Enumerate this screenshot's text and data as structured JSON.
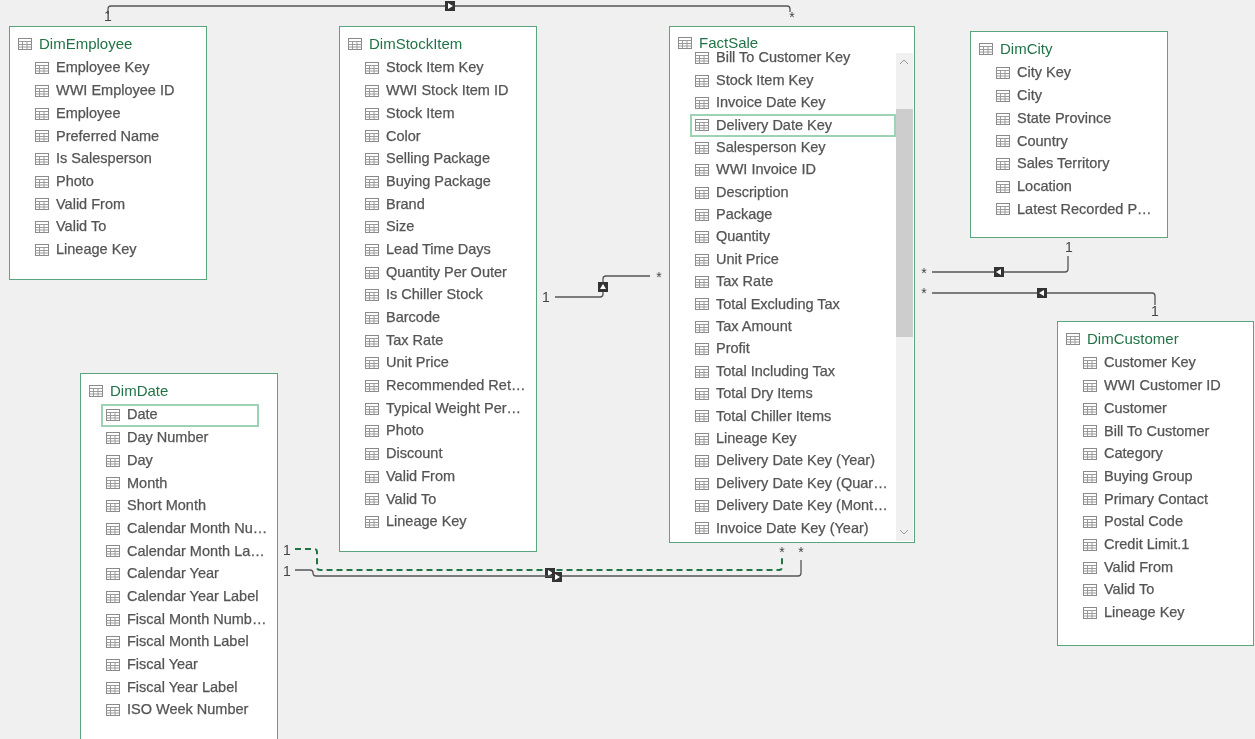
{
  "tables": [
    {
      "name": "DimEmployee",
      "columns": [
        {
          "label": "Employee Key",
          "selected": false
        },
        {
          "label": "WWI Employee ID",
          "selected": false
        },
        {
          "label": "Employee",
          "selected": false
        },
        {
          "label": "Preferred Name",
          "selected": false
        },
        {
          "label": "Is Salesperson",
          "selected": false
        },
        {
          "label": "Photo",
          "selected": false
        },
        {
          "label": "Valid From",
          "selected": false
        },
        {
          "label": "Valid To",
          "selected": false
        },
        {
          "label": "Lineage Key",
          "selected": false
        }
      ]
    },
    {
      "name": "DimStockItem",
      "columns": [
        {
          "label": "Stock Item Key",
          "selected": false
        },
        {
          "label": "WWI Stock Item ID",
          "selected": false
        },
        {
          "label": "Stock Item",
          "selected": false
        },
        {
          "label": "Color",
          "selected": false
        },
        {
          "label": "Selling Package",
          "selected": false
        },
        {
          "label": "Buying Package",
          "selected": false
        },
        {
          "label": "Brand",
          "selected": false
        },
        {
          "label": "Size",
          "selected": false
        },
        {
          "label": "Lead Time Days",
          "selected": false
        },
        {
          "label": "Quantity Per Outer",
          "selected": false
        },
        {
          "label": "Is Chiller Stock",
          "selected": false
        },
        {
          "label": "Barcode",
          "selected": false
        },
        {
          "label": "Tax Rate",
          "selected": false
        },
        {
          "label": "Unit Price",
          "selected": false
        },
        {
          "label": "Recommended Ret…",
          "selected": false
        },
        {
          "label": "Typical Weight Per…",
          "selected": false
        },
        {
          "label": "Photo",
          "selected": false
        },
        {
          "label": "Discount",
          "selected": false
        },
        {
          "label": "Valid From",
          "selected": false
        },
        {
          "label": "Valid To",
          "selected": false
        },
        {
          "label": "Lineage Key",
          "selected": false
        }
      ]
    },
    {
      "name": "FactSale",
      "scrollable": true,
      "columns": [
        {
          "label": "Bill To Customer Key",
          "selected": false
        },
        {
          "label": "Stock Item Key",
          "selected": false
        },
        {
          "label": "Invoice Date Key",
          "selected": false
        },
        {
          "label": "Delivery Date Key",
          "selected": true
        },
        {
          "label": "Salesperson Key",
          "selected": false
        },
        {
          "label": "WWI Invoice ID",
          "selected": false
        },
        {
          "label": "Description",
          "selected": false
        },
        {
          "label": "Package",
          "selected": false
        },
        {
          "label": "Quantity",
          "selected": false
        },
        {
          "label": "Unit Price",
          "selected": false
        },
        {
          "label": "Tax Rate",
          "selected": false
        },
        {
          "label": "Total Excluding Tax",
          "selected": false
        },
        {
          "label": "Tax Amount",
          "selected": false
        },
        {
          "label": "Profit",
          "selected": false
        },
        {
          "label": "Total Including Tax",
          "selected": false
        },
        {
          "label": "Total Dry Items",
          "selected": false
        },
        {
          "label": "Total Chiller Items",
          "selected": false
        },
        {
          "label": "Lineage Key",
          "selected": false
        },
        {
          "label": "Delivery Date Key (Year)",
          "selected": false
        },
        {
          "label": "Delivery Date Key (Quar…",
          "selected": false
        },
        {
          "label": "Delivery Date Key (Mont…",
          "selected": false
        },
        {
          "label": "Invoice Date Key (Year)",
          "selected": false
        }
      ]
    },
    {
      "name": "DimCity",
      "columns": [
        {
          "label": "City Key",
          "selected": false
        },
        {
          "label": "City",
          "selected": false
        },
        {
          "label": "State Province",
          "selected": false
        },
        {
          "label": "Country",
          "selected": false
        },
        {
          "label": "Sales Territory",
          "selected": false
        },
        {
          "label": "Location",
          "selected": false
        },
        {
          "label": "Latest Recorded P…",
          "selected": false
        }
      ]
    },
    {
      "name": "DimDate",
      "columns": [
        {
          "label": "Date",
          "selected": true
        },
        {
          "label": "Day Number",
          "selected": false
        },
        {
          "label": "Day",
          "selected": false
        },
        {
          "label": "Month",
          "selected": false
        },
        {
          "label": "Short Month",
          "selected": false
        },
        {
          "label": "Calendar Month Nu…",
          "selected": false
        },
        {
          "label": "Calendar Month La…",
          "selected": false
        },
        {
          "label": "Calendar Year",
          "selected": false
        },
        {
          "label": "Calendar Year Label",
          "selected": false
        },
        {
          "label": "Fiscal Month Numb…",
          "selected": false
        },
        {
          "label": "Fiscal Month Label",
          "selected": false
        },
        {
          "label": "Fiscal Year",
          "selected": false
        },
        {
          "label": "Fiscal Year Label",
          "selected": false
        },
        {
          "label": "ISO Week Number",
          "selected": false
        }
      ]
    },
    {
      "name": "DimCustomer",
      "columns": [
        {
          "label": "Customer Key",
          "selected": false
        },
        {
          "label": "WWI Customer ID",
          "selected": false
        },
        {
          "label": "Customer",
          "selected": false
        },
        {
          "label": "Bill To Customer",
          "selected": false
        },
        {
          "label": "Category",
          "selected": false
        },
        {
          "label": "Buying Group",
          "selected": false
        },
        {
          "label": "Primary Contact",
          "selected": false
        },
        {
          "label": "Postal Code",
          "selected": false
        },
        {
          "label": "Credit Limit.1",
          "selected": false
        },
        {
          "label": "Valid From",
          "selected": false
        },
        {
          "label": "Valid To",
          "selected": false
        },
        {
          "label": "Lineage Key",
          "selected": false
        }
      ]
    }
  ],
  "relationships": [
    {
      "one_label": "1",
      "many_label": "*",
      "selected": false
    },
    {
      "one_label": "1",
      "many_label": "*",
      "selected": false
    },
    {
      "one_label": "1",
      "many_label": "*",
      "selected": false
    },
    {
      "one_label": "1",
      "many_label": "*",
      "selected": false
    },
    {
      "one_label": "1",
      "many_label": "*",
      "selected": true
    },
    {
      "one_label": "1",
      "many_label": "*",
      "selected": false
    }
  ]
}
